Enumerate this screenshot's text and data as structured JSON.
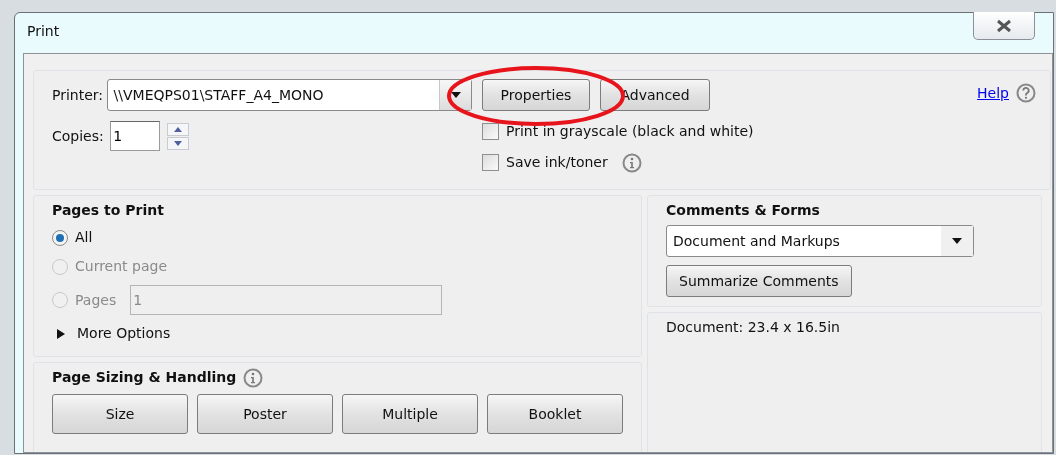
{
  "window": {
    "title": "Print"
  },
  "printer": {
    "label": "Printer:",
    "value": "\\\\VMEQPS01\\STAFF_A4_MONO",
    "buttons": [
      {
        "label": "Properties",
        "highlighted": true
      },
      {
        "label": "Advanced",
        "highlighted": false
      }
    ]
  },
  "help": {
    "label": "Help"
  },
  "copies": {
    "label": "Copies:",
    "value": "1"
  },
  "options": [
    {
      "label": "Print in grayscale (black and white)",
      "checked": false,
      "info": false
    },
    {
      "label": "Save ink/toner",
      "checked": false,
      "info": true
    }
  ],
  "pages_to_print": {
    "title": "Pages to Print",
    "choices": [
      {
        "label": "All",
        "selected": true,
        "disabled": false
      },
      {
        "label": "Current page",
        "selected": false,
        "disabled": true
      },
      {
        "label": "Pages",
        "selected": false,
        "disabled": true,
        "value": "1"
      }
    ],
    "more_options": {
      "label": "More Options",
      "expanded": false
    }
  },
  "page_sizing": {
    "title": "Page Sizing & Handling",
    "buttons": [
      "Size",
      "Poster",
      "Multiple",
      "Booklet"
    ]
  },
  "comments_forms": {
    "title": "Comments & Forms",
    "value": "Document and Markups",
    "button": "Summarize Comments"
  },
  "preview": {
    "document_size": "Document: 23.4 x 16.5in"
  }
}
